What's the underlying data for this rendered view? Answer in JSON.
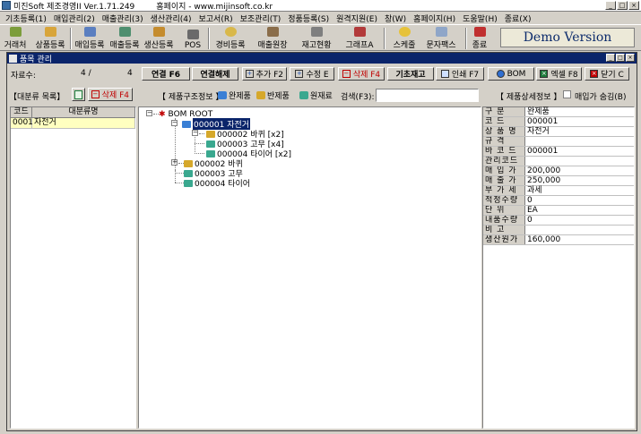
{
  "app": {
    "title": "미진Soft 제조경영II Ver.1.71.249",
    "homepage": "홈페이지 - www.mijinsoft.co.kr",
    "window_buttons": [
      "_",
      "□",
      "×"
    ]
  },
  "menu": [
    "기초등록(1)",
    "매입관리(2)",
    "매출관리(3)",
    "생산관리(4)",
    "보고서(R)",
    "보조관리(T)",
    "정품등록(S)",
    "원격지원(E)",
    "창(W)",
    "홈페이지(H)",
    "도움말(H)",
    "종료(X)"
  ],
  "toolbar": {
    "buttons": [
      "거래처",
      "상품등록",
      "매입등록",
      "매출등록",
      "생산등록",
      "POS",
      "경비등록",
      "매출원장",
      "재고현황",
      "그래프A",
      "스케줄",
      "문자팩스",
      "종료"
    ],
    "icons": [
      "handshake-icon",
      "product-icon",
      "purchase-icon",
      "sales-icon",
      "production-icon",
      "pos-icon",
      "expense-icon",
      "ledger-icon",
      "inventory-icon",
      "chart-icon",
      "schedule-icon",
      "fax-icon",
      "exit-icon"
    ],
    "demo_label": "Demo Version"
  },
  "window": {
    "title": "품목 관리",
    "buttons": [
      "_",
      "□",
      "×"
    ]
  },
  "record": {
    "label": "자료수:",
    "current": "4 /",
    "total": "4"
  },
  "actions": {
    "link": "연결 F6",
    "unlink": "연결해제",
    "add": "추가 F2",
    "edit": "수정 E",
    "delete": "삭제 F4",
    "base_stock": "기초재고",
    "print": "인쇄 F7",
    "bom": "BOM",
    "excel": "엑셀 F8",
    "close": "닫기 C"
  },
  "category": {
    "label": "【대분류 목록】",
    "delete": "삭제 F4",
    "headers": [
      "코드",
      "대분류명"
    ],
    "rows": [
      {
        "code": "0001",
        "name": "자전거"
      }
    ]
  },
  "structure": {
    "label": "【 제품구조정보 】",
    "legend": [
      "완제품",
      "반제품",
      "원재료"
    ],
    "search_label": "검색(F3):",
    "search_value": ""
  },
  "detail": {
    "label": "【 제품상세정보 】",
    "hide_label": "매입가 숨김(B)",
    "hide_checked": false,
    "rows": [
      {
        "label": "구    분",
        "value": "완제품"
      },
      {
        "label": "코    드",
        "value": "000001"
      },
      {
        "label": "상 품 명",
        "value": "자전거"
      },
      {
        "label": "규    격",
        "value": ""
      },
      {
        "label": "바 코 드",
        "value": "000001"
      },
      {
        "label": "관리코드",
        "value": ""
      },
      {
        "label": "매 입 가",
        "value": "200,000"
      },
      {
        "label": "매 출 가",
        "value": "250,000"
      },
      {
        "label": "부 가 세",
        "value": "과세"
      },
      {
        "label": "적정수량",
        "value": "0"
      },
      {
        "label": "단    위",
        "value": "EA"
      },
      {
        "label": "내품수량",
        "value": "0"
      },
      {
        "label": "비    고",
        "value": ""
      },
      {
        "label": "생산원가",
        "value": "160,000"
      }
    ]
  },
  "tree": {
    "root": "BOM ROOT",
    "nodes": [
      {
        "code": "000001",
        "name": "자전거",
        "qty": ""
      },
      {
        "code": "000002",
        "name": "바퀴",
        "qty": "[x2]"
      },
      {
        "code": "000003",
        "name": "고무",
        "qty": "[x4]"
      },
      {
        "code": "000004",
        "name": "타이어",
        "qty": "[x2]"
      },
      {
        "code": "000002",
        "name": "바퀴",
        "qty": ""
      },
      {
        "code": "000003",
        "name": "고무",
        "qty": ""
      },
      {
        "code": "000004",
        "name": "타이어",
        "qty": ""
      }
    ],
    "labels": [
      "000001 자전거",
      "000002 바퀴 [x2]",
      "000003 고무 [x4]",
      "000004 타이어 [x2]",
      "000002 바퀴",
      "000003 고무",
      "000004 타이어"
    ]
  },
  "colors": {
    "title_bar": "#0a246a",
    "selected_row": "#ffffc0",
    "finished_icon": "#3a7fd5",
    "semi_icon": "#d6a82a",
    "raw_icon": "#3aa88f"
  }
}
